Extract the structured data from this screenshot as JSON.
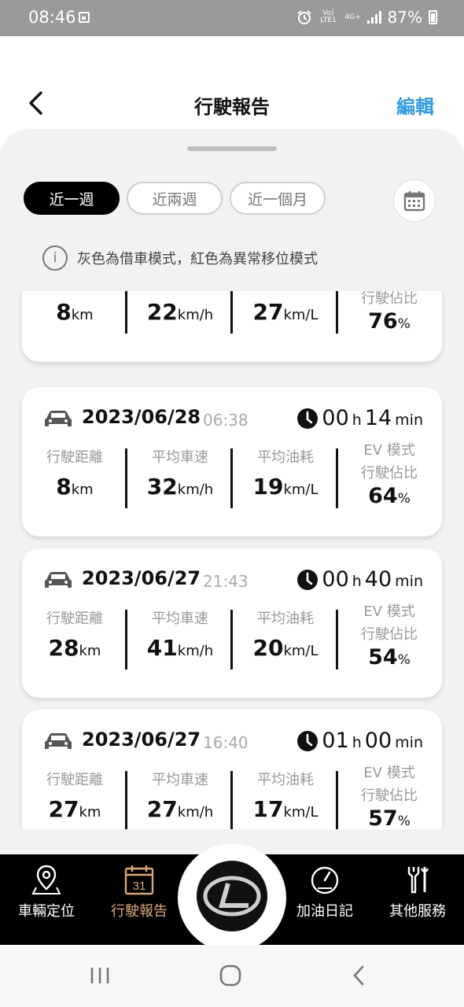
{
  "status_bar": {
    "time": "08:46",
    "volte": "Vo) LTE1",
    "network": "4G+",
    "battery": "87%"
  },
  "header": {
    "title": "行駛報告",
    "edit_label": "編輯"
  },
  "filters": {
    "options": [
      "近一週",
      "近兩週",
      "近一個月"
    ],
    "selected": "近一週"
  },
  "notice": "灰色為借車模式，紅色為異常移位模式",
  "labels": {
    "distance": "行駛距離",
    "avg_speed": "平均車速",
    "avg_fuel": "平均油耗",
    "ev_line1": "EV 模式",
    "ev_line2": "行駛佔比",
    "km": "km",
    "kmh": "km/h",
    "kml": "km/L",
    "percent": "%",
    "h": "h",
    "min": "min"
  },
  "trips": [
    {
      "date": "",
      "time": "",
      "hours": "",
      "minutes": "",
      "distance": "8",
      "speed": "22",
      "fuel": "27",
      "ev": "76"
    },
    {
      "date": "2023/06/28",
      "time": "06:38",
      "hours": "00",
      "minutes": "14",
      "distance": "8",
      "speed": "32",
      "fuel": "19",
      "ev": "64"
    },
    {
      "date": "2023/06/27",
      "time": "21:43",
      "hours": "00",
      "minutes": "40",
      "distance": "28",
      "speed": "41",
      "fuel": "20",
      "ev": "54"
    },
    {
      "date": "2023/06/27",
      "time": "16:40",
      "hours": "01",
      "minutes": "00",
      "distance": "27",
      "speed": "27",
      "fuel": "17",
      "ev": "57"
    }
  ],
  "bottom_nav": {
    "items": [
      "車輛定位",
      "行駛報告",
      "加油日記",
      "其他服務"
    ],
    "calendar_day": "31",
    "active": "行駛報告"
  }
}
